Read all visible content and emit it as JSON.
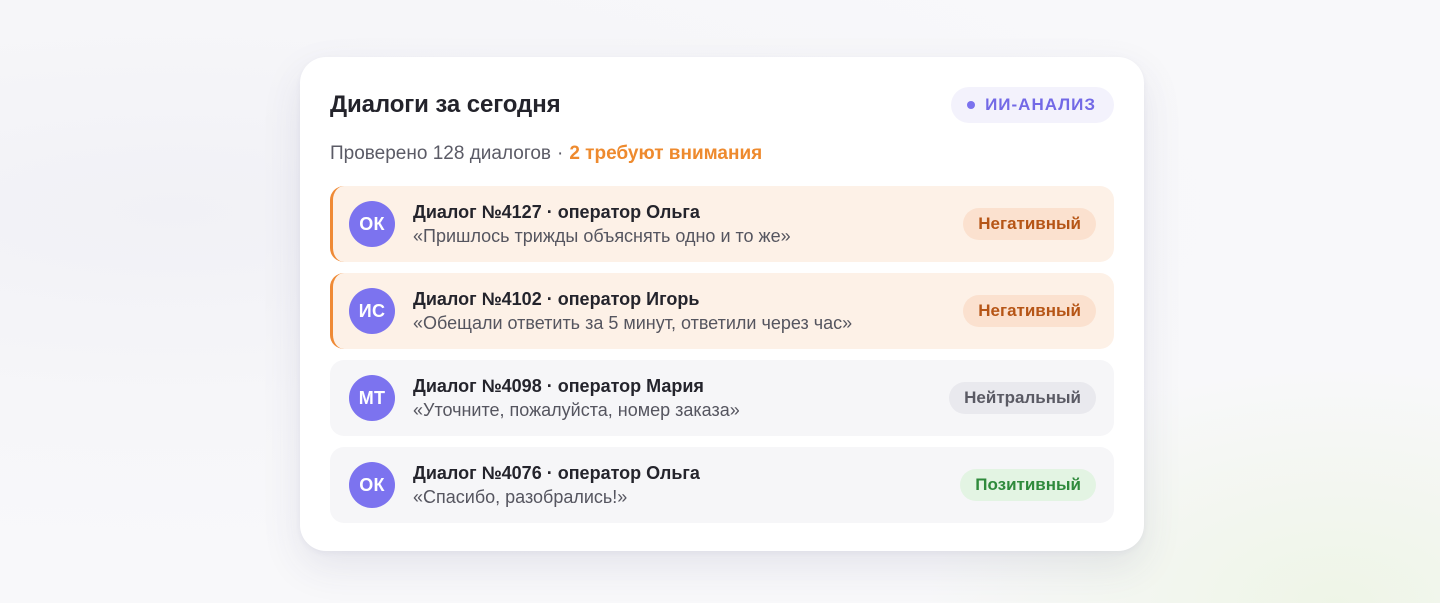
{
  "card": {
    "title": "Диалоги за сегодня",
    "ai_badge": "ИИ-АНАЛИЗ",
    "summary": {
      "checked": "Проверено 128 диалогов",
      "separator": "·",
      "attention": "2 требуют внимания"
    }
  },
  "dialogs": [
    {
      "initials": "ОК",
      "title": "Диалог №4127 · оператор Ольга",
      "quote": "«Пришлось трижды объяснять одно и то же»",
      "sentiment": "Негативный",
      "sentiment_type": "negative",
      "flagged": true
    },
    {
      "initials": "ИС",
      "title": "Диалог №4102 · оператор Игорь",
      "quote": "«Обещали ответить за 5 минут, ответили через час»",
      "sentiment": "Негативный",
      "sentiment_type": "negative",
      "flagged": true
    },
    {
      "initials": "МТ",
      "title": "Диалог №4098 · оператор Мария",
      "quote": "«Уточните, пожалуйста, номер заказа»",
      "sentiment": "Нейтральный",
      "sentiment_type": "neutral",
      "flagged": false
    },
    {
      "initials": "ОК",
      "title": "Диалог №4076 · оператор Ольга",
      "quote": "«Спасибо, разобрались!»",
      "sentiment": "Позитивный",
      "sentiment_type": "positive",
      "flagged": false
    }
  ],
  "colors": {
    "accent": "#7c73ef",
    "attention": "#ee8a2e",
    "negative_bg": "#fbe1cf",
    "negative_text": "#b65516",
    "neutral_bg": "#e9e9ee",
    "neutral_text": "#5a5a64",
    "positive_bg": "#e3f4e3",
    "positive_text": "#2f8a3c"
  }
}
